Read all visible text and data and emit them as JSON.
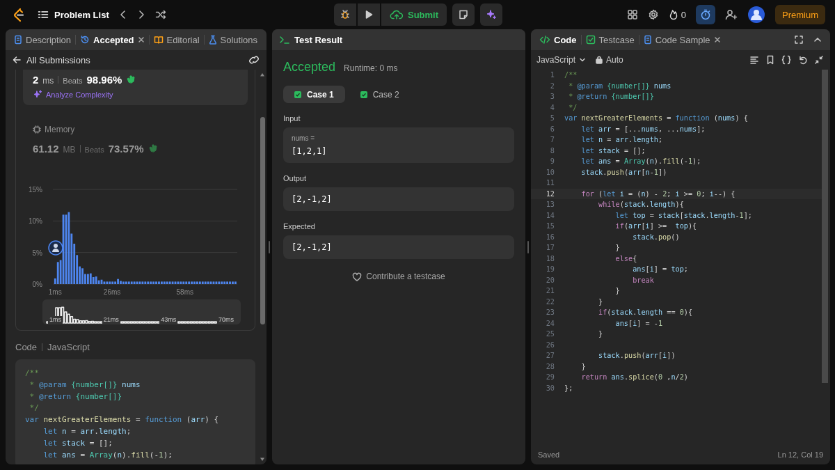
{
  "top_bar": {
    "problem_list": "Problem List",
    "submit": "Submit",
    "streak": "0",
    "timer_on": true,
    "premium": "Premium"
  },
  "left_panel": {
    "tabs": [
      {
        "label": "Description",
        "kind": "description",
        "selected": false,
        "closable": false
      },
      {
        "label": "Accepted",
        "kind": "submission",
        "selected": true,
        "closable": true
      },
      {
        "label": "Editorial",
        "kind": "editorial",
        "selected": false,
        "closable": false
      },
      {
        "label": "Solutions",
        "kind": "solutions",
        "selected": false,
        "closable": false
      }
    ],
    "back_link": "All Submissions",
    "runtime": {
      "value": "2",
      "unit": "ms",
      "beats_label": "Beats",
      "beats": "98.96%",
      "analyze": "Analyze Complexity"
    },
    "memory": {
      "title": "Memory",
      "value": "61.12",
      "unit": "MB",
      "beats_label": "Beats",
      "beats": "73.57%",
      "chart_data": {
        "type": "bar",
        "xlim": [
          0,
          81
        ],
        "ylim": [
          0,
          15
        ],
        "yticks": [
          {
            "value": 0,
            "label": "0%"
          },
          {
            "value": 5,
            "label": "5%"
          },
          {
            "value": 10,
            "label": "10%"
          },
          {
            "value": 15,
            "label": "15%"
          }
        ],
        "xticks": [
          {
            "value": 1,
            "label": "1ms"
          },
          {
            "value": 26,
            "label": "26ms"
          },
          {
            "value": 58,
            "label": "58ms"
          }
        ],
        "x": [
          1,
          2.2,
          3.4,
          4.6,
          5.8,
          7,
          8.2,
          9.4,
          10.6,
          11.8,
          13,
          14.2,
          15.4,
          16.6,
          17.8,
          19,
          20.2,
          21.4,
          22.6,
          23.8,
          25,
          26.2,
          27.4,
          28.6,
          29.8,
          31,
          32.2,
          33.4,
          34.6,
          35.8,
          37,
          38.2,
          39.4,
          40.6,
          41.8,
          43,
          44.2,
          45.4,
          46.6,
          47.8,
          49,
          50.2,
          51.4,
          52.6,
          53.8,
          55,
          56.2,
          57.4,
          58.6,
          59.8,
          61,
          62.2,
          63.4,
          64.6,
          65.8,
          67,
          68.2,
          69.4,
          70.6,
          71.8,
          73,
          74.2,
          75.4,
          76.6,
          77.8,
          79,
          80.2
        ],
        "values": [
          0.9,
          3.5,
          3.8,
          11,
          11,
          11.4,
          8,
          6.4,
          4.6,
          2.8,
          2.5,
          1.6,
          1.6,
          1.7,
          1.1,
          1.2,
          0.6,
          0.7,
          0.4,
          0.4,
          0.4,
          0.4,
          0.4,
          0.8,
          0.5,
          0.4,
          0.4,
          0.4,
          0.4,
          0.4,
          0.4,
          0.4,
          0.4,
          0.4,
          0.4,
          0.4,
          0.4,
          0.4,
          0.4,
          0.4,
          0.4,
          0.4,
          0.4,
          0.4,
          0.4,
          0.4,
          0.4,
          0.4,
          0.4,
          0.4,
          0.4,
          0.4,
          0.4,
          0.4,
          0.4,
          0.4,
          0.4,
          0.4,
          0.4,
          0.4,
          0.4,
          0.4,
          0.4,
          0.4,
          0.4,
          0.4,
          0.4
        ]
      },
      "navigator_labels": [
        "1ms",
        "21ms",
        "43ms",
        "70ms"
      ]
    },
    "code_heading": {
      "label": "Code",
      "language": "JavaScript"
    },
    "code_lines": [
      [
        {
          "kind": "c",
          "text": "/**"
        }
      ],
      [
        {
          "kind": "c",
          "text": " * "
        },
        {
          "kind": "tag",
          "text": "@param"
        },
        {
          "kind": "type",
          "text": " {number[]}"
        },
        {
          "kind": "id",
          "text": " nums"
        }
      ],
      [
        {
          "kind": "c",
          "text": " * "
        },
        {
          "kind": "tag",
          "text": "@return"
        },
        {
          "kind": "type",
          "text": " {number[]}"
        }
      ],
      [
        {
          "kind": "c",
          "text": " */"
        }
      ],
      [
        {
          "kind": "kw",
          "text": "var"
        },
        {
          "kind": "fn",
          "text": " nextGreaterElements"
        },
        {
          "kind": "p",
          "text": " = "
        },
        {
          "kind": "kw",
          "text": "function"
        },
        {
          "kind": "p",
          "text": " ("
        },
        {
          "kind": "id",
          "text": "arr"
        },
        {
          "kind": "p",
          "text": ") {"
        }
      ],
      [
        {
          "kind": "kw",
          "text": "    let"
        },
        {
          "kind": "id",
          "text": " n"
        },
        {
          "kind": "p",
          "text": " = "
        },
        {
          "kind": "id",
          "text": "arr"
        },
        {
          "kind": "p",
          "text": "."
        },
        {
          "kind": "id",
          "text": "length"
        },
        {
          "kind": "p",
          "text": ";"
        }
      ],
      [
        {
          "kind": "kw",
          "text": "    let"
        },
        {
          "kind": "id",
          "text": " stack"
        },
        {
          "kind": "p",
          "text": " = [];"
        }
      ],
      [
        {
          "kind": "kw",
          "text": "    let"
        },
        {
          "kind": "id",
          "text": " ans"
        },
        {
          "kind": "p",
          "text": " = "
        },
        {
          "kind": "type",
          "text": "Array"
        },
        {
          "kind": "p",
          "text": "("
        },
        {
          "kind": "id",
          "text": "n"
        },
        {
          "kind": "p",
          "text": ")."
        },
        {
          "kind": "fn",
          "text": "fill"
        },
        {
          "kind": "p",
          "text": "(-"
        },
        {
          "kind": "num",
          "text": "1"
        },
        {
          "kind": "p",
          "text": ");"
        }
      ]
    ]
  },
  "middle_panel": {
    "title": "Test Result",
    "status": "Accepted",
    "runtime": "Runtime: 0 ms",
    "cases": [
      {
        "label": "Case 1",
        "selected": true,
        "passed": true
      },
      {
        "label": "Case 2",
        "selected": false,
        "passed": true
      }
    ],
    "input_label": "Input",
    "inputs": [
      {
        "name": "nums =",
        "value": "[1,2,1]"
      }
    ],
    "output_label": "Output",
    "output": "[2,-1,2]",
    "expected_label": "Expected",
    "expected": "[2,-1,2]",
    "contribute": "Contribute a testcase"
  },
  "right_panel": {
    "tabs": [
      {
        "label": "Code",
        "kind": "code",
        "selected": true,
        "closable": false
      },
      {
        "label": "Testcase",
        "kind": "testcase",
        "selected": false,
        "closable": false
      },
      {
        "label": "Code Sample",
        "kind": "sample",
        "selected": false,
        "closable": true
      }
    ],
    "language": "JavaScript",
    "mode": "Auto",
    "lines": [
      {
        "number": "1",
        "current": false,
        "tokens": [
          {
            "kind": "c",
            "text": "/**"
          }
        ]
      },
      {
        "number": "2",
        "current": false,
        "tokens": [
          {
            "kind": "c",
            "text": " * "
          },
          {
            "kind": "tag",
            "text": "@param"
          },
          {
            "kind": "type",
            "text": " {number[]}"
          },
          {
            "kind": "id",
            "text": " nums"
          }
        ]
      },
      {
        "number": "3",
        "current": false,
        "tokens": [
          {
            "kind": "c",
            "text": " * "
          },
          {
            "kind": "tag",
            "text": "@return"
          },
          {
            "kind": "type",
            "text": " {number[]}"
          }
        ]
      },
      {
        "number": "4",
        "current": false,
        "tokens": [
          {
            "kind": "c",
            "text": " */"
          }
        ]
      },
      {
        "number": "5",
        "current": false,
        "tokens": [
          {
            "kind": "kw",
            "text": "var"
          },
          {
            "kind": "fn",
            "text": " nextGreaterElements"
          },
          {
            "kind": "p",
            "text": " = "
          },
          {
            "kind": "kw",
            "text": "function"
          },
          {
            "kind": "p",
            "text": " ("
          },
          {
            "kind": "id",
            "text": "nums"
          },
          {
            "kind": "p",
            "text": ") {"
          }
        ]
      },
      {
        "number": "6",
        "current": false,
        "tokens": [
          {
            "kind": "kw",
            "text": "    let"
          },
          {
            "kind": "id",
            "text": " arr"
          },
          {
            "kind": "p",
            "text": " = [..."
          },
          {
            "kind": "id",
            "text": "nums"
          },
          {
            "kind": "p",
            "text": ", ..."
          },
          {
            "kind": "id",
            "text": "nums"
          },
          {
            "kind": "p",
            "text": "];"
          }
        ]
      },
      {
        "number": "7",
        "current": false,
        "tokens": [
          {
            "kind": "kw",
            "text": "    let"
          },
          {
            "kind": "id",
            "text": " n"
          },
          {
            "kind": "p",
            "text": " = "
          },
          {
            "kind": "id",
            "text": "arr"
          },
          {
            "kind": "p",
            "text": "."
          },
          {
            "kind": "id",
            "text": "length"
          },
          {
            "kind": "p",
            "text": ";"
          }
        ]
      },
      {
        "number": "8",
        "current": false,
        "tokens": [
          {
            "kind": "kw",
            "text": "    let"
          },
          {
            "kind": "id",
            "text": " stack"
          },
          {
            "kind": "p",
            "text": " = [];"
          }
        ]
      },
      {
        "number": "9",
        "current": false,
        "tokens": [
          {
            "kind": "kw",
            "text": "    let"
          },
          {
            "kind": "id",
            "text": " ans"
          },
          {
            "kind": "p",
            "text": " = "
          },
          {
            "kind": "type",
            "text": "Array"
          },
          {
            "kind": "p",
            "text": "("
          },
          {
            "kind": "id",
            "text": "n"
          },
          {
            "kind": "p",
            "text": ")."
          },
          {
            "kind": "fn",
            "text": "fill"
          },
          {
            "kind": "p",
            "text": "(-"
          },
          {
            "kind": "num",
            "text": "1"
          },
          {
            "kind": "p",
            "text": ");"
          }
        ]
      },
      {
        "number": "10",
        "current": false,
        "tokens": [
          {
            "kind": "id",
            "text": "    stack"
          },
          {
            "kind": "p",
            "text": "."
          },
          {
            "kind": "fn",
            "text": "push"
          },
          {
            "kind": "p",
            "text": "("
          },
          {
            "kind": "id",
            "text": "arr"
          },
          {
            "kind": "p",
            "text": "["
          },
          {
            "kind": "id",
            "text": "n"
          },
          {
            "kind": "p",
            "text": "-"
          },
          {
            "kind": "num",
            "text": "1"
          },
          {
            "kind": "p",
            "text": "])"
          }
        ]
      },
      {
        "number": "11",
        "current": false
      },
      {
        "number": "12",
        "current": true,
        "tokens": [
          {
            "kind": "ctl",
            "text": "    for"
          },
          {
            "kind": "p",
            "text": " ("
          },
          {
            "kind": "kw",
            "text": "let"
          },
          {
            "kind": "id",
            "text": " i"
          },
          {
            "kind": "p",
            "text": " = ("
          },
          {
            "kind": "id",
            "text": "n"
          },
          {
            "kind": "p",
            "text": ") - "
          },
          {
            "kind": "num",
            "text": "2"
          },
          {
            "kind": "p",
            "text": "; "
          },
          {
            "kind": "id",
            "text": "i"
          },
          {
            "kind": "p",
            "text": " >= "
          },
          {
            "kind": "num",
            "text": "0"
          },
          {
            "kind": "p",
            "text": "; "
          },
          {
            "kind": "id",
            "text": "i"
          },
          {
            "kind": "p",
            "text": "--) {"
          }
        ]
      },
      {
        "number": "13",
        "current": false,
        "tokens": [
          {
            "kind": "ctl",
            "text": "        while"
          },
          {
            "kind": "p",
            "text": "("
          },
          {
            "kind": "id",
            "text": "stack"
          },
          {
            "kind": "p",
            "text": "."
          },
          {
            "kind": "id",
            "text": "length"
          },
          {
            "kind": "p",
            "text": "){"
          }
        ]
      },
      {
        "number": "14",
        "current": false,
        "tokens": [
          {
            "kind": "kw",
            "text": "            let"
          },
          {
            "kind": "id",
            "text": " top"
          },
          {
            "kind": "p",
            "text": " = "
          },
          {
            "kind": "id",
            "text": "stack"
          },
          {
            "kind": "p",
            "text": "["
          },
          {
            "kind": "id",
            "text": "stack"
          },
          {
            "kind": "p",
            "text": "."
          },
          {
            "kind": "id",
            "text": "length"
          },
          {
            "kind": "p",
            "text": "-"
          },
          {
            "kind": "num",
            "text": "1"
          },
          {
            "kind": "p",
            "text": "];"
          }
        ]
      },
      {
        "number": "15",
        "current": false,
        "tokens": [
          {
            "kind": "ctl",
            "text": "            if"
          },
          {
            "kind": "p",
            "text": "("
          },
          {
            "kind": "id",
            "text": "arr"
          },
          {
            "kind": "p",
            "text": "["
          },
          {
            "kind": "id",
            "text": "i"
          },
          {
            "kind": "p",
            "text": "] >=  "
          },
          {
            "kind": "id",
            "text": "top"
          },
          {
            "kind": "p",
            "text": "){"
          }
        ]
      },
      {
        "number": "16",
        "current": false,
        "tokens": [
          {
            "kind": "id",
            "text": "                stack"
          },
          {
            "kind": "p",
            "text": "."
          },
          {
            "kind": "fn",
            "text": "pop"
          },
          {
            "kind": "p",
            "text": "()"
          }
        ]
      },
      {
        "number": "17",
        "current": false,
        "tokens": [
          {
            "kind": "p",
            "text": "            }"
          }
        ]
      },
      {
        "number": "18",
        "current": false,
        "tokens": [
          {
            "kind": "ctl",
            "text": "            else"
          },
          {
            "kind": "p",
            "text": "{"
          }
        ]
      },
      {
        "number": "19",
        "current": false,
        "tokens": [
          {
            "kind": "id",
            "text": "                ans"
          },
          {
            "kind": "p",
            "text": "["
          },
          {
            "kind": "id",
            "text": "i"
          },
          {
            "kind": "p",
            "text": "] = "
          },
          {
            "kind": "id",
            "text": "top"
          },
          {
            "kind": "p",
            "text": ";"
          }
        ]
      },
      {
        "number": "20",
        "current": false,
        "tokens": [
          {
            "kind": "ctl",
            "text": "                break"
          }
        ]
      },
      {
        "number": "21",
        "current": false,
        "tokens": [
          {
            "kind": "p",
            "text": "            }"
          }
        ]
      },
      {
        "number": "22",
        "current": false,
        "tokens": [
          {
            "kind": "p",
            "text": "        }"
          }
        ]
      },
      {
        "number": "23",
        "current": false,
        "tokens": [
          {
            "kind": "ctl",
            "text": "        if"
          },
          {
            "kind": "p",
            "text": "("
          },
          {
            "kind": "id",
            "text": "stack"
          },
          {
            "kind": "p",
            "text": "."
          },
          {
            "kind": "id",
            "text": "length"
          },
          {
            "kind": "p",
            "text": " == "
          },
          {
            "kind": "num",
            "text": "0"
          },
          {
            "kind": "p",
            "text": "){"
          }
        ]
      },
      {
        "number": "24",
        "current": false,
        "tokens": [
          {
            "kind": "id",
            "text": "            ans"
          },
          {
            "kind": "p",
            "text": "["
          },
          {
            "kind": "id",
            "text": "i"
          },
          {
            "kind": "p",
            "text": "] = -"
          },
          {
            "kind": "num",
            "text": "1"
          }
        ]
      },
      {
        "number": "25",
        "current": false,
        "tokens": [
          {
            "kind": "p",
            "text": "        }"
          }
        ]
      },
      {
        "number": "26",
        "current": false
      },
      {
        "number": "27",
        "current": false,
        "tokens": [
          {
            "kind": "id",
            "text": "        stack"
          },
          {
            "kind": "p",
            "text": "."
          },
          {
            "kind": "fn",
            "text": "push"
          },
          {
            "kind": "p",
            "text": "("
          },
          {
            "kind": "id",
            "text": "arr"
          },
          {
            "kind": "p",
            "text": "["
          },
          {
            "kind": "id",
            "text": "i"
          },
          {
            "kind": "p",
            "text": "])"
          }
        ]
      },
      {
        "number": "28",
        "current": false,
        "tokens": [
          {
            "kind": "p",
            "text": "    }"
          }
        ]
      },
      {
        "number": "29",
        "current": false,
        "tokens": [
          {
            "kind": "ctl",
            "text": "    return"
          },
          {
            "kind": "id",
            "text": " ans"
          },
          {
            "kind": "p",
            "text": "."
          },
          {
            "kind": "fn",
            "text": "splice"
          },
          {
            "kind": "p",
            "text": "("
          },
          {
            "kind": "num",
            "text": "0"
          },
          {
            "kind": "p",
            "text": " ,"
          },
          {
            "kind": "id",
            "text": "n"
          },
          {
            "kind": "p",
            "text": "/"
          },
          {
            "kind": "num",
            "text": "2"
          },
          {
            "kind": "p",
            "text": ")"
          }
        ]
      },
      {
        "number": "30",
        "current": false,
        "tokens": [
          {
            "kind": "p",
            "text": "};"
          }
        ]
      }
    ],
    "status": "Saved",
    "cursor": "Ln 12, Col 19"
  }
}
